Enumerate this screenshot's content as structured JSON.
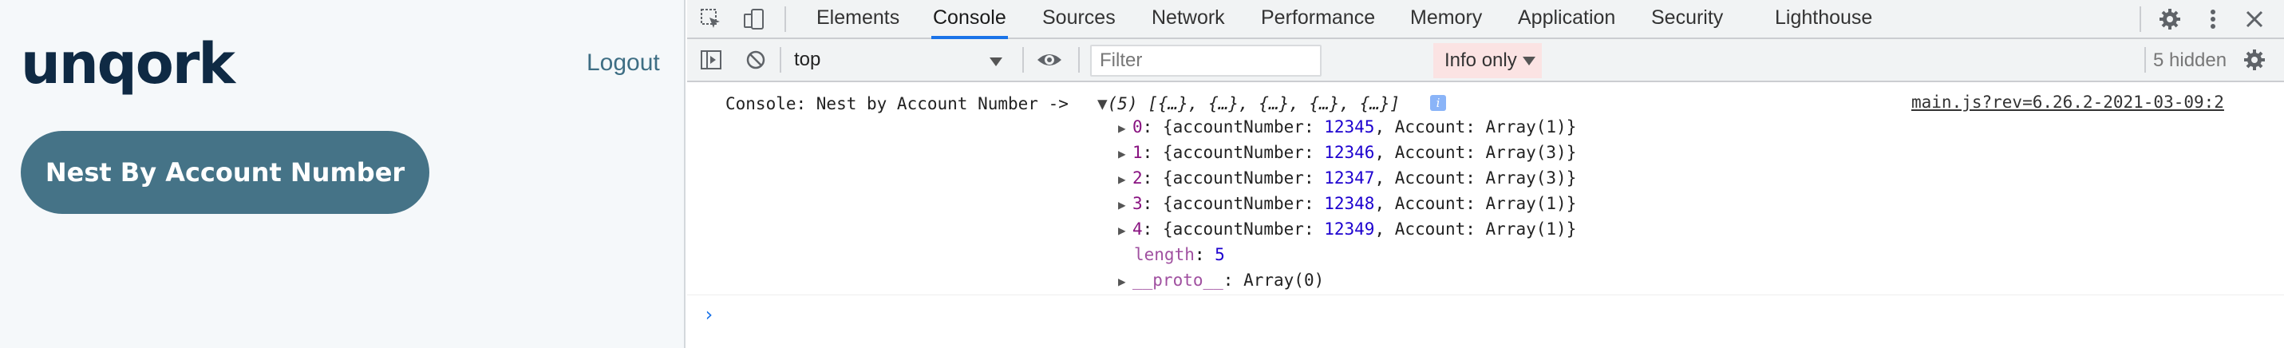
{
  "app": {
    "logo_text": "unqork",
    "logout_label": "Logout",
    "nest_button_label": "Nest By Account Number"
  },
  "devtools": {
    "tabs": [
      {
        "label": "Elements",
        "active": false
      },
      {
        "label": "Console",
        "active": true
      },
      {
        "label": "Sources",
        "active": false
      },
      {
        "label": "Network",
        "active": false
      },
      {
        "label": "Performance",
        "active": false
      },
      {
        "label": "Memory",
        "active": false
      },
      {
        "label": "Application",
        "active": false
      },
      {
        "label": "Security",
        "active": false
      },
      {
        "label": "Lighthouse",
        "active": false
      }
    ],
    "toolbar": {
      "context": "top",
      "filter_placeholder": "Filter",
      "levels": "Info only",
      "hidden_count": "5 hidden"
    },
    "console": {
      "message_prefix": "Console: Nest by Account Number ->",
      "summary": "(5) [{…}, {…}, {…}, {…}, {…}]",
      "source_link": "main.js?rev=6.26.2-2021-03-09:2",
      "entries": [
        {
          "index": "0",
          "account_number": "12345",
          "account": "Array(1)"
        },
        {
          "index": "1",
          "account_number": "12346",
          "account": "Array(3)"
        },
        {
          "index": "2",
          "account_number": "12347",
          "account": "Array(3)"
        },
        {
          "index": "3",
          "account_number": "12348",
          "account": "Array(1)"
        },
        {
          "index": "4",
          "account_number": "12349",
          "account": "Array(1)"
        }
      ],
      "length_key": "length",
      "length_value": "5",
      "proto_key": "__proto__",
      "proto_value": "Array(0)"
    }
  }
}
